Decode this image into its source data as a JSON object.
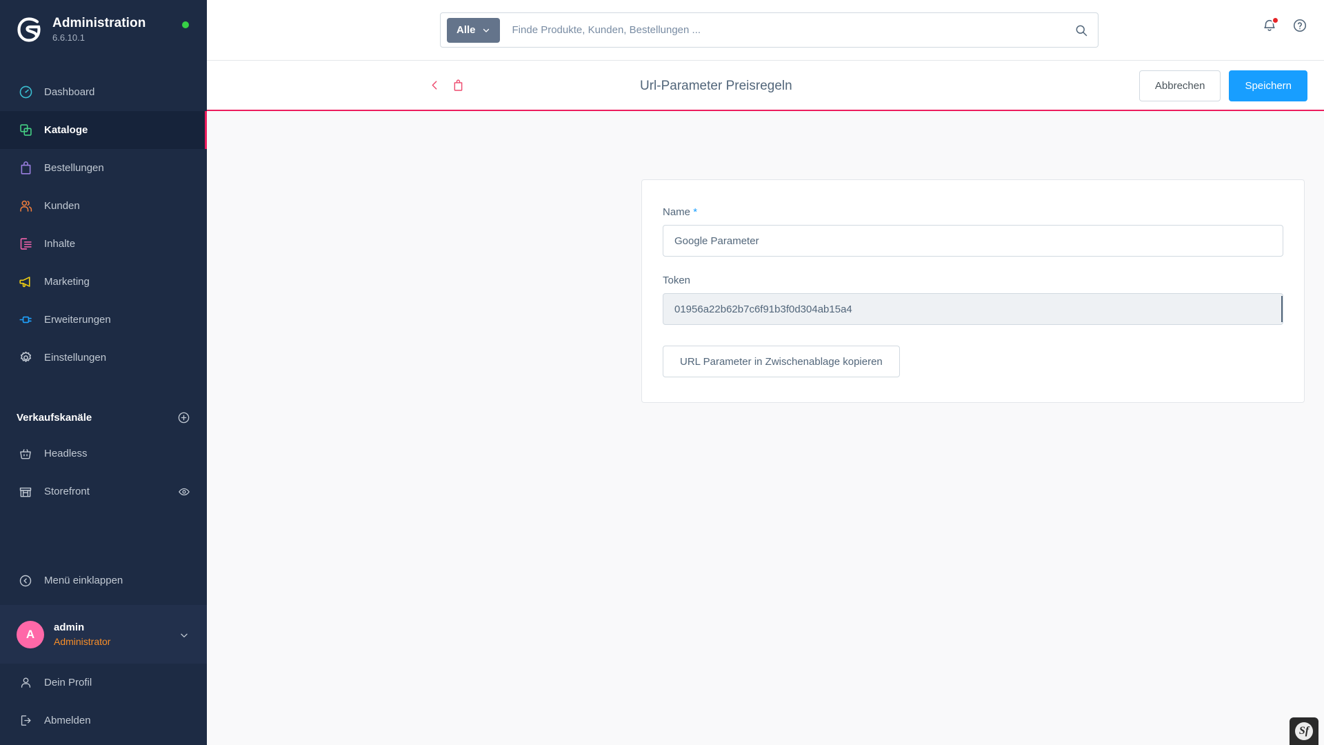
{
  "sidebar": {
    "brand": {
      "title": "Administration",
      "version": "6.6.10.1",
      "status_color": "#37d046",
      "logo_icon": "shopware-logo-icon"
    },
    "nav": [
      {
        "label": "Dashboard",
        "icon": "dashboard-icon",
        "color": "#3bbfd1",
        "active": false
      },
      {
        "label": "Kataloge",
        "icon": "catalog-icon",
        "color": "#45d184",
        "active": true
      },
      {
        "label": "Bestellungen",
        "icon": "orders-bag-icon",
        "color": "#9a7fe0",
        "active": false
      },
      {
        "label": "Kunden",
        "icon": "customers-icon",
        "color": "#f07d3c",
        "active": false
      },
      {
        "label": "Inhalte",
        "icon": "content-icon",
        "color": "#f563ac",
        "active": false
      },
      {
        "label": "Marketing",
        "icon": "megaphone-icon",
        "color": "#f2d012",
        "active": false
      },
      {
        "label": "Erweiterungen",
        "icon": "plugin-icon",
        "color": "#1fa3ff",
        "active": false
      },
      {
        "label": "Einstellungen",
        "icon": "gear-icon",
        "color": "#c1c9d3",
        "active": false
      }
    ],
    "sales_channels": {
      "title": "Verkaufskanäle",
      "add_icon": "plus-circle-icon",
      "items": [
        {
          "label": "Headless",
          "icon": "basket-icon",
          "trailing_icon": ""
        },
        {
          "label": "Storefront",
          "icon": "storefront-icon",
          "trailing_icon": "eye-icon"
        }
      ]
    },
    "collapse": {
      "label": "Menü einklappen",
      "icon": "chevron-left-circle-icon"
    },
    "user": {
      "initial": "A",
      "name": "admin",
      "role": "Administrator",
      "caret_icon": "chevron-down-icon"
    },
    "footer": [
      {
        "label": "Dein Profil",
        "icon": "user-icon"
      },
      {
        "label": "Abmelden",
        "icon": "logout-icon"
      }
    ]
  },
  "topbar": {
    "search": {
      "scope_label": "Alle",
      "scope_caret_icon": "chevron-down-icon",
      "placeholder": "Finde Produkte, Kunden, Bestellungen ...",
      "value": "",
      "submit_icon": "search-icon"
    },
    "notifications_icon": "bell-icon",
    "notifications_badge_color": "#e52427",
    "help_icon": "help-circle-icon"
  },
  "page_header": {
    "back_icon": "chevron-left-icon",
    "entity_icon": "orders-bag-icon",
    "accent_color": "#ed1c5d",
    "title": "Url-Parameter Preisregeln",
    "cancel_label": "Abbrechen",
    "save_label": "Speichern"
  },
  "form": {
    "name": {
      "label": "Name",
      "required_marker": "*",
      "value": "Google Parameter",
      "placeholder": ""
    },
    "token": {
      "label": "Token",
      "value": "01956a22b62b7c6f91b3f0d304ab15a4",
      "readonly": true
    },
    "copy_button_label": "URL Parameter in Zwischenablage kopieren"
  },
  "debug_toolbar": {
    "label": "Sf",
    "name": "symfony-profiler-badge"
  }
}
